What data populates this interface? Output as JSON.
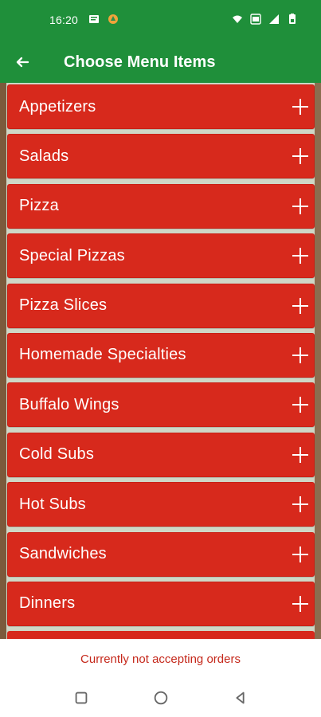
{
  "status_bar": {
    "time": "16:20"
  },
  "app_bar": {
    "title": "Choose Menu Items"
  },
  "menu": {
    "items": [
      {
        "label": "Appetizers"
      },
      {
        "label": "Salads"
      },
      {
        "label": "Pizza"
      },
      {
        "label": "Special Pizzas"
      },
      {
        "label": "Pizza Slices"
      },
      {
        "label": "Homemade Specialties"
      },
      {
        "label": "Buffalo Wings"
      },
      {
        "label": "Cold Subs"
      },
      {
        "label": "Hot Subs"
      },
      {
        "label": "Sandwiches"
      },
      {
        "label": "Dinners"
      }
    ]
  },
  "footer": {
    "order_status": "Currently not accepting orders"
  },
  "icons": {
    "back": "arrow-left-icon",
    "expand": "plus-icon",
    "wifi": "wifi-icon",
    "signal": "signal-icon",
    "battery": "battery-icon"
  },
  "colors": {
    "app_bar": "#1f8f3a",
    "menu_item": "#d7291c",
    "status_text": "#c5281b"
  }
}
